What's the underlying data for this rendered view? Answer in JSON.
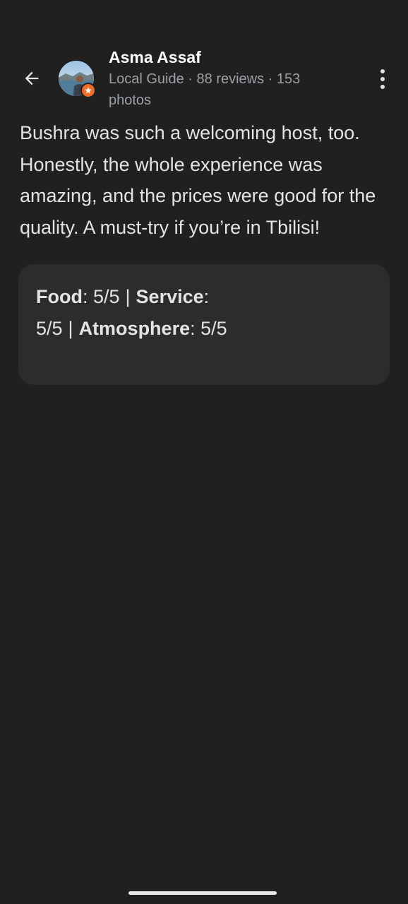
{
  "header": {
    "back_icon": "arrow-back-icon",
    "avatar_icon": "profile-photo",
    "badge_icon": "local-guide-star-icon",
    "author_name": "Asma Assaf",
    "author_meta": "Local Guide · 88 reviews · 153 photos",
    "more_icon": "more-vert-icon"
  },
  "review": {
    "text": "Bushra was such a welcoming host, too. Honestly, the whole experience was amazing, and the prices were good for the quality. A must-try if you’re in Tbilisi!"
  },
  "ratings": {
    "food_label": "Food",
    "food_value": ": 5/5",
    "separator": "|",
    "service_label": "Service",
    "service_value": ": 5/5",
    "atmosphere_label": "Atmosphere",
    "atmosphere_value": ": 5/5"
  },
  "colors": {
    "background": "#202020",
    "card": "#2b2c2e",
    "badge": "#f06a28",
    "muted_text": "#9aa0a6"
  }
}
